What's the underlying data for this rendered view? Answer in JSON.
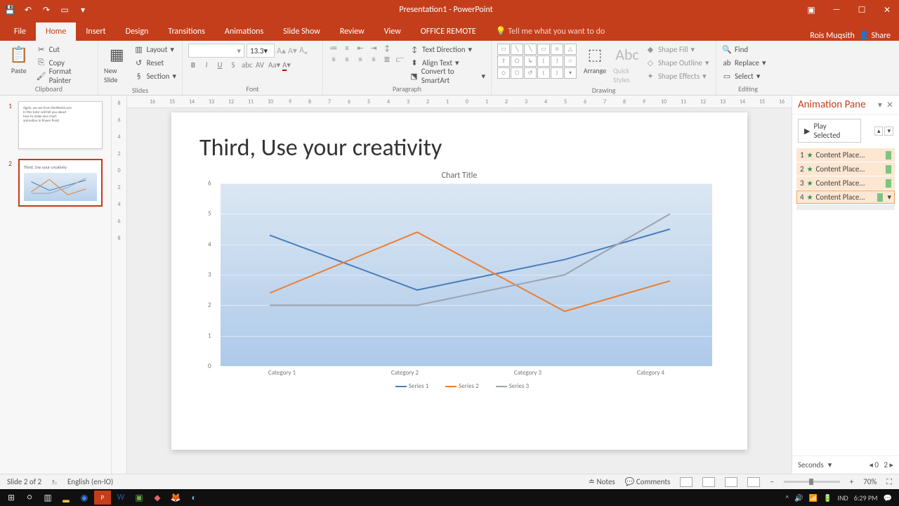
{
  "titlebar": {
    "title": "Presentation1 - PowerPoint"
  },
  "user": {
    "name": "Rois Muqsith",
    "share": "Share"
  },
  "tabs": [
    "File",
    "Home",
    "Insert",
    "Design",
    "Transitions",
    "Animations",
    "Slide Show",
    "Review",
    "View",
    "OFFICE REMOTE"
  ],
  "active_tab": "Home",
  "tell_me": "Tell me what you want to do",
  "ribbon": {
    "clipboard": {
      "paste": "Paste",
      "cut": "Cut",
      "copy": "Copy",
      "format_painter": "Format Painter",
      "label": "Clipboard"
    },
    "slides": {
      "new_slide": "New Slide",
      "layout": "Layout",
      "reset": "Reset",
      "section": "Section",
      "label": "Slides"
    },
    "font": {
      "size": "13.3",
      "label": "Font"
    },
    "paragraph": {
      "text_direction": "Text Direction",
      "align_text": "Align Text",
      "smartart": "Convert to SmartArt",
      "label": "Paragraph"
    },
    "drawing": {
      "arrange": "Arrange",
      "quick_styles": "Quick Styles",
      "shape_fill": "Shape Fill",
      "shape_outline": "Shape Outline",
      "shape_effects": "Shape Effects",
      "label": "Drawing"
    },
    "editing": {
      "find": "Find",
      "replace": "Replace",
      "select": "Select",
      "label": "Editing"
    }
  },
  "thumbs": [
    {
      "num": "1",
      "selected": false
    },
    {
      "num": "2",
      "selected": true
    }
  ],
  "slide": {
    "title": "Third, Use your creativity"
  },
  "chart_data": {
    "type": "line",
    "title": "Chart Title",
    "categories": [
      "Category 1",
      "Category 2",
      "Category 3",
      "Category 4"
    ],
    "series": [
      {
        "name": "Series 1",
        "color": "#4a7ebb",
        "values": [
          4.3,
          2.5,
          3.5,
          4.5
        ]
      },
      {
        "name": "Series 2",
        "color": "#ed7d31",
        "values": [
          2.4,
          4.4,
          1.8,
          2.8
        ]
      },
      {
        "name": "Series 3",
        "color": "#9ca3af",
        "values": [
          2.0,
          2.0,
          3.0,
          5.0
        ]
      }
    ],
    "yticks": [
      0,
      1,
      2,
      3,
      4,
      5,
      6
    ],
    "ylim": [
      0,
      6
    ]
  },
  "anim_seq": [
    "1",
    "2",
    "3",
    "4"
  ],
  "animpane": {
    "title": "Animation Pane",
    "play": "Play Selected",
    "items": [
      {
        "n": "1",
        "label": "Content Place..."
      },
      {
        "n": "2",
        "label": "Content Place..."
      },
      {
        "n": "3",
        "label": "Content Place..."
      },
      {
        "n": "4",
        "label": "Content Place..."
      }
    ],
    "seconds": "Seconds",
    "range_from": "0",
    "range_to": "2"
  },
  "status": {
    "slide": "Slide 2 of 2",
    "lang": "English (en-IO)",
    "notes": "Notes",
    "comments": "Comments",
    "zoom": "70%"
  },
  "taskbar": {
    "lang": "IND",
    "time": "6:29 PM"
  }
}
